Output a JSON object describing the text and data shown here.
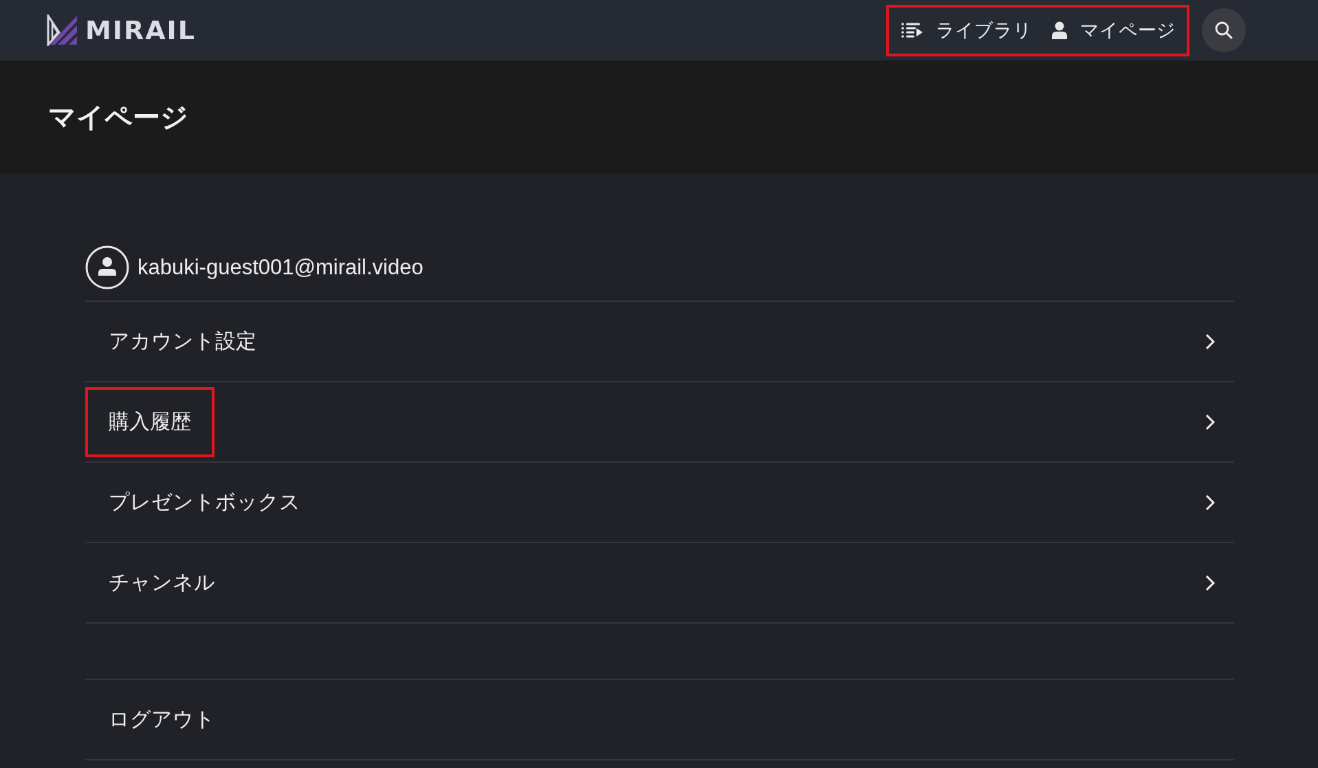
{
  "header": {
    "logo": "MIRAIL",
    "nav_highlighted": true,
    "nav": [
      {
        "kind": "library",
        "label": "ライブラリ"
      },
      {
        "kind": "mypage",
        "label": "マイページ"
      }
    ]
  },
  "page_title": "マイページ",
  "account": {
    "email": "kabuki-guest001@mirail.video"
  },
  "menu": [
    {
      "label": "アカウント設定",
      "highlighted": false
    },
    {
      "label": "購入履歴",
      "highlighted": true
    },
    {
      "label": "プレゼントボックス",
      "highlighted": false
    },
    {
      "label": "チャンネル",
      "highlighted": false
    }
  ],
  "logout": {
    "label": "ログアウト"
  }
}
